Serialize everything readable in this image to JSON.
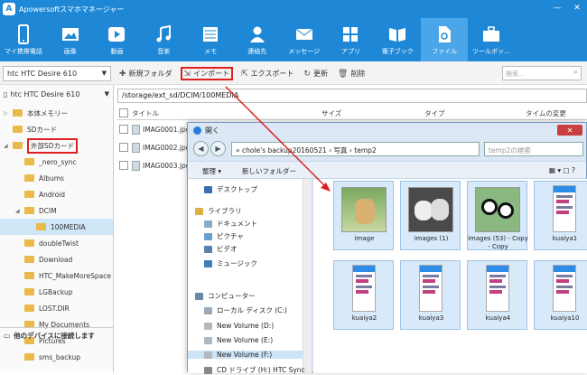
{
  "app": {
    "title": "Apowersoftスマホマネージャー"
  },
  "toolbar": [
    {
      "label": "マイ携帯電話",
      "icon": "phone-icon"
    },
    {
      "label": "画像",
      "icon": "image-icon"
    },
    {
      "label": "動画",
      "icon": "video-icon"
    },
    {
      "label": "音楽",
      "icon": "music-icon"
    },
    {
      "label": "メモ",
      "icon": "notes-icon"
    },
    {
      "label": "連絡先",
      "icon": "contact-icon"
    },
    {
      "label": "メッセージ",
      "icon": "message-icon"
    },
    {
      "label": "アプリ",
      "icon": "apps-icon"
    },
    {
      "label": "電子ブック",
      "icon": "book-icon"
    },
    {
      "label": "ファイル",
      "icon": "file-icon",
      "active": true
    },
    {
      "label": "ツールボッ...",
      "icon": "toolbox-icon"
    }
  ],
  "device": {
    "selector": "htc HTC Desire 610",
    "name": "htc HTC Desire 610"
  },
  "actions": {
    "new_folder": "新規フォルダ",
    "import": "インポート",
    "export": "エクスポート",
    "refresh": "更新",
    "delete": "削除"
  },
  "search": {
    "placeholder": "検索..."
  },
  "tree": [
    {
      "label": "本体メモリー",
      "level": 0,
      "arrow": "▷"
    },
    {
      "label": "SDカード",
      "level": 0,
      "arrow": ""
    },
    {
      "label": "外部SDカード",
      "level": 0,
      "arrow": "◢",
      "highlight": true
    },
    {
      "label": "_nero_sync",
      "level": 1
    },
    {
      "label": "Albums",
      "level": 1
    },
    {
      "label": "Android",
      "level": 1
    },
    {
      "label": "DCIM",
      "level": 1,
      "arrow": "◢"
    },
    {
      "label": "100MEDIA",
      "level": 2,
      "selected": true
    },
    {
      "label": "doubleTwist",
      "level": 1
    },
    {
      "label": "Download",
      "level": 1
    },
    {
      "label": "HTC_MakeMoreSpace",
      "level": 1
    },
    {
      "label": "LGBackup",
      "level": 1
    },
    {
      "label": "LOST.DIR",
      "level": 1
    },
    {
      "label": "My Documents",
      "level": 1
    },
    {
      "label": "Pictures",
      "level": 1
    },
    {
      "label": "sms_backup",
      "level": 1
    }
  ],
  "connect_label": "他のデバイスに接続します",
  "path": "/storage/ext_sd/DCIM/100MEDIA",
  "columns": {
    "title": "タイトル",
    "size": "サイズ",
    "type": "タイプ",
    "time": "タイムの変更"
  },
  "files": [
    "IMAG0001.jpg",
    "IMAG0002.jpg",
    "IMAG0003.jpg"
  ],
  "dialog": {
    "title": "開く",
    "address": "« chole's backup20160521 › 写真 › temp2",
    "search": "temp2の検索",
    "organize": "整理 ▾",
    "new_folder": "新しいフォルダー",
    "nav": [
      {
        "label": "デスクトップ",
        "color": "#3c6fb0"
      },
      {
        "label": "ライブラリ",
        "color": "#e0b040"
      },
      {
        "label": "ドキュメント",
        "color": "#8aa8c8"
      },
      {
        "label": "ピクチャ",
        "color": "#6aa0d0"
      },
      {
        "label": "ビデオ",
        "color": "#5c7fb0"
      },
      {
        "label": "ミュージック",
        "color": "#3a80c0"
      },
      {
        "label": "コンピューター",
        "color": "#6a88a8"
      },
      {
        "label": "ローカル ディスク (C:)",
        "color": "#9aa8b8"
      },
      {
        "label": "New Volume (D:)",
        "color": "#b0b8c0"
      },
      {
        "label": "New Volume (E:)",
        "color": "#b0b8c0"
      },
      {
        "label": "New Volume (F:)",
        "color": "#b0b8c0",
        "selected": true
      },
      {
        "label": "CD ドライブ (H:) HTC Sync",
        "color": "#888"
      }
    ],
    "thumbs": [
      {
        "label": "image",
        "kind": "dog"
      },
      {
        "label": "images (1)",
        "kind": "husky"
      },
      {
        "label": "images (53) - Copy - Copy",
        "kind": "panda"
      },
      {
        "label": "kuaiya1",
        "kind": "phone"
      },
      {
        "label": "kuaiya2",
        "kind": "phone"
      },
      {
        "label": "kuaiya3",
        "kind": "phone"
      },
      {
        "label": "kuaiya4",
        "kind": "phone"
      },
      {
        "label": "kuaiya10",
        "kind": "phone"
      }
    ]
  },
  "colors": {
    "accent": "#1e88d6",
    "highlight": "#e02020"
  }
}
